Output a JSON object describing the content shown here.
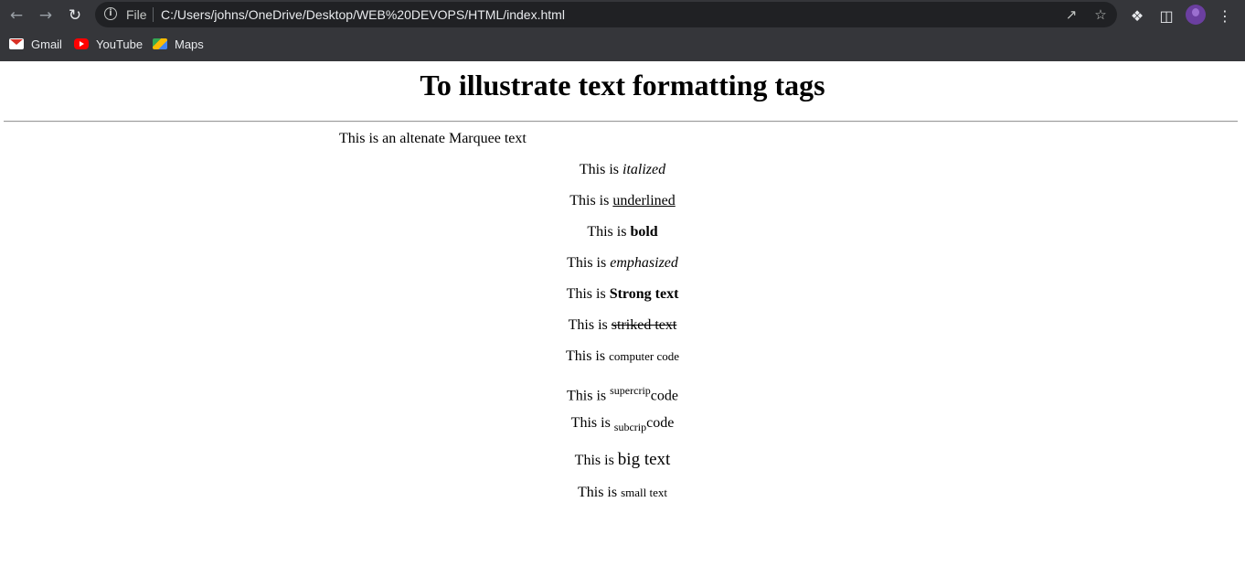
{
  "browser": {
    "url_scheme_label": "File",
    "url": "C:/Users/johns/OneDrive/Desktop/WEB%20DEVOPS/HTML/index.html",
    "bookmarks": [
      {
        "label": "Gmail",
        "icon": "gmail-icon"
      },
      {
        "label": "YouTube",
        "icon": "youtube-icon"
      },
      {
        "label": "Maps",
        "icon": "maps-icon"
      }
    ]
  },
  "page": {
    "heading": "To illustrate text formatting tags",
    "marquee_text": "This is an altenate Marquee text",
    "lines": {
      "italic": {
        "prefix": "This is ",
        "text": "italized"
      },
      "underline": {
        "prefix": "This is ",
        "text": "underlined"
      },
      "bold": {
        "prefix": "This is ",
        "text": "bold"
      },
      "emphasized": {
        "prefix": "This is ",
        "text": "emphasized"
      },
      "strong": {
        "prefix": "This is ",
        "text": "Strong text"
      },
      "striked": {
        "prefix": "This is ",
        "text": "striked text"
      },
      "code": {
        "prefix": "This is ",
        "text": "computer code"
      },
      "superscript": {
        "prefix": "This is ",
        "script": "supercrip",
        "suffix": "code"
      },
      "subscript": {
        "prefix": "This is ",
        "script": "subcrip",
        "suffix": "code"
      },
      "big": {
        "prefix": "This is ",
        "text": "big text"
      },
      "small": {
        "prefix": "This is ",
        "text": "small text"
      }
    }
  }
}
